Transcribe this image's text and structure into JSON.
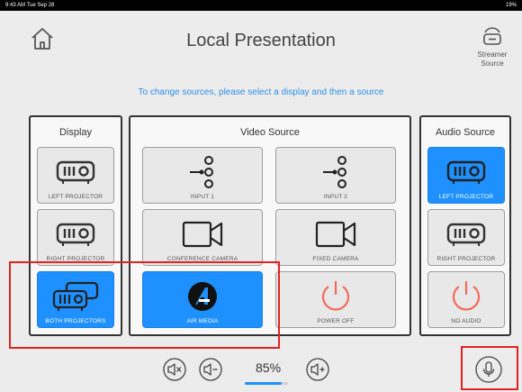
{
  "status_bar": {
    "time_date": "9:43 AM  Tue Sep 28",
    "battery": "19%"
  },
  "header": {
    "title": "Local Presentation",
    "home_icon": "home-icon",
    "streamer_label_line1": "Streamer",
    "streamer_label_line2": "Source",
    "streamer_icon": "cast-icon"
  },
  "hint": "To change sources, please select a display and then a source",
  "display_panel": {
    "title": "Display",
    "items": [
      {
        "label": "LEFT PROJECTOR",
        "icon": "projector-icon",
        "selected": false
      },
      {
        "label": "RIGHT PROJECTOR",
        "icon": "projector-icon",
        "selected": false
      },
      {
        "label": "BOTH PROJECTORS",
        "icon": "dual-projector-icon",
        "selected": true
      }
    ]
  },
  "video_panel": {
    "title": "Video Source",
    "items": [
      {
        "label": "INPUT 1",
        "icon": "input-icon",
        "selected": false
      },
      {
        "label": "INPUT 2",
        "icon": "input-icon",
        "selected": false
      },
      {
        "label": "CONFERENCE CAMERA",
        "icon": "camera-icon",
        "selected": false
      },
      {
        "label": "FIXED CAMERA",
        "icon": "camera-icon",
        "selected": false
      },
      {
        "label": "AIR MEDIA",
        "icon": "airmedia-icon",
        "selected": true
      },
      {
        "label": "POWER OFF",
        "icon": "power-icon",
        "selected": false
      }
    ]
  },
  "audio_panel": {
    "title": "Audio Source",
    "items": [
      {
        "label": "LEFT PROJECTOR",
        "icon": "projector-icon",
        "selected": true
      },
      {
        "label": "RIGHT PROJECTOR",
        "icon": "projector-icon",
        "selected": false
      },
      {
        "label": "NO AUDIO",
        "icon": "power-icon",
        "selected": false
      }
    ]
  },
  "volume": {
    "level_text": "85%",
    "level": 0.85
  },
  "colors": {
    "accent": "#1e90ff",
    "annotation": "#e32222",
    "power": "#f26b5b"
  }
}
